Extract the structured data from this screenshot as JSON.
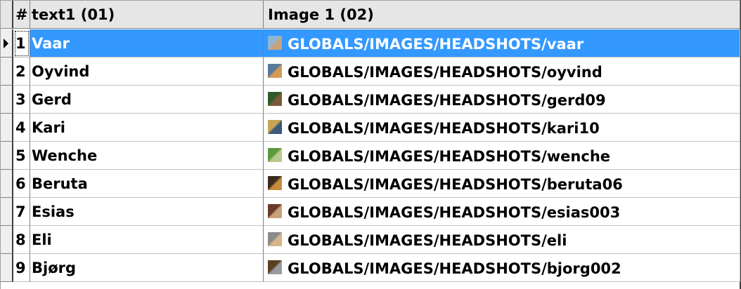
{
  "columns": {
    "num": "#",
    "text1": "text1 (01)",
    "image1": "Image 1 (02)"
  },
  "rows": [
    {
      "num": "1",
      "text1": "Vaar",
      "image_path": "GLOBALS/IMAGES/HEADSHOTS/vaar",
      "thumb_colors": [
        "#8fb6d6",
        "#c9a27a"
      ],
      "selected": true
    },
    {
      "num": "2",
      "text1": "Oyvind",
      "image_path": "GLOBALS/IMAGES/HEADSHOTS/oyvind",
      "thumb_colors": [
        "#5a7a9a",
        "#d39a5a"
      ]
    },
    {
      "num": "3",
      "text1": "Gerd",
      "image_path": "GLOBALS/IMAGES/HEADSHOTS/gerd09",
      "thumb_colors": [
        "#2f5a2a",
        "#7b5a3a"
      ]
    },
    {
      "num": "4",
      "text1": "Kari",
      "image_path": "GLOBALS/IMAGES/HEADSHOTS/kari10",
      "thumb_colors": [
        "#c7a455",
        "#3a5a7a"
      ]
    },
    {
      "num": "5",
      "text1": "Wenche",
      "image_path": "GLOBALS/IMAGES/HEADSHOTS/wenche",
      "thumb_colors": [
        "#5a9a3a",
        "#b8c98a"
      ]
    },
    {
      "num": "6",
      "text1": "Beruta",
      "image_path": "GLOBALS/IMAGES/HEADSHOTS/beruta06",
      "thumb_colors": [
        "#3a2a20",
        "#c98a3a"
      ]
    },
    {
      "num": "7",
      "text1": "Esias",
      "image_path": "GLOBALS/IMAGES/HEADSHOTS/esias003",
      "thumb_colors": [
        "#6a3a2a",
        "#c9a07a"
      ]
    },
    {
      "num": "8",
      "text1": "Eli",
      "image_path": "GLOBALS/IMAGES/HEADSHOTS/eli",
      "thumb_colors": [
        "#8a8a8a",
        "#d6b58a"
      ]
    },
    {
      "num": "9",
      "text1": "Bjørg",
      "image_path": "GLOBALS/IMAGES/HEADSHOTS/bjorg002",
      "thumb_colors": [
        "#5a4020",
        "#9a9aa0"
      ]
    }
  ],
  "colors": {
    "selection": "#3399ff",
    "header_bg": "#e6e6e6"
  }
}
